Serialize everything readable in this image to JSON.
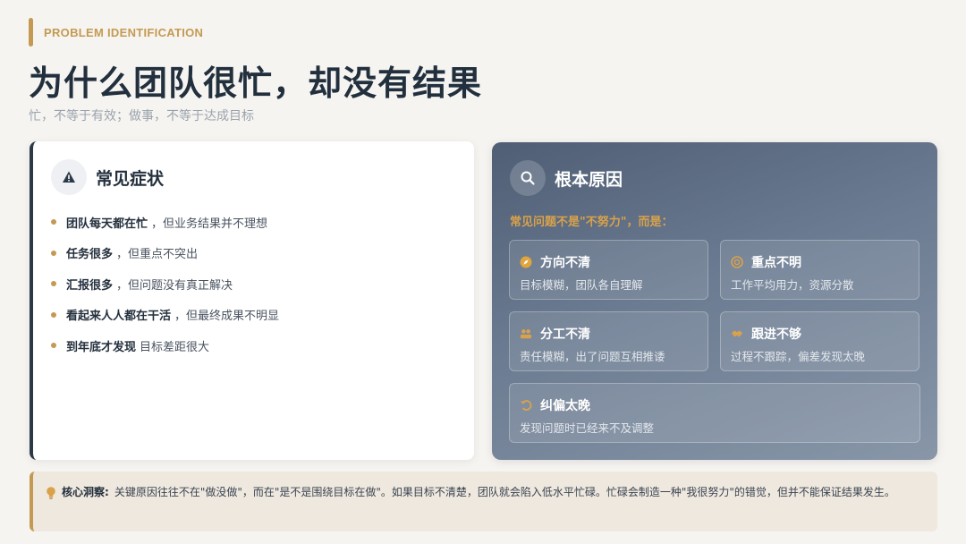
{
  "header": {
    "eyebrow": "PROBLEM IDENTIFICATION",
    "title": "为什么团队很忙，却没有结果",
    "subtitle": "忙，不等于有效；做事，不等于达成目标"
  },
  "symptoms_card": {
    "title": "常见症状",
    "icon": "warning-icon",
    "items": [
      {
        "strong": "团队每天都在忙",
        "rest": "，但业务结果并不理想"
      },
      {
        "strong": "任务很多",
        "rest": "，但重点不突出"
      },
      {
        "strong": "汇报很多",
        "rest": "，但问题没有真正解决"
      },
      {
        "strong": "看起来人人都在干活",
        "rest": "，但最终成果不明显"
      },
      {
        "strong": "到年底才发现",
        "rest": "目标差距很大"
      }
    ]
  },
  "causes_card": {
    "title": "根本原因",
    "icon": "search-icon",
    "subtitle": "常见问题不是\"不努力\"，而是：",
    "causes": [
      {
        "title": "方向不清",
        "desc": "目标模糊，团队各自理解",
        "icon": "compass-icon"
      },
      {
        "title": "重点不明",
        "desc": "工作平均用力，资源分散",
        "icon": "target-icon"
      },
      {
        "title": "分工不清",
        "desc": "责任模糊，出了问题互相推诿",
        "icon": "users-icon"
      },
      {
        "title": "跟进不够",
        "desc": "过程不跟踪，偏差发现太晚",
        "icon": "handshake-icon"
      },
      {
        "title": "纠偏太晚",
        "desc": "发现问题时已经来不及调整",
        "icon": "undo-icon"
      }
    ]
  },
  "insight": {
    "label": "核心洞察:",
    "text": "关键原因往往不在\"做没做\"，而在\"是不是围绕目标在做\"。如果目标不清楚，团队就会陷入低水平忙碌。忙碌会制造一种\"我很努力\"的错觉，但并不能保证结果发生。",
    "icon": "lightbulb-icon"
  },
  "colors": {
    "accent": "#c49a52",
    "dark": "#24303d",
    "panel_gradient_start": "#4f5e75",
    "panel_gradient_end": "#8896a8"
  }
}
